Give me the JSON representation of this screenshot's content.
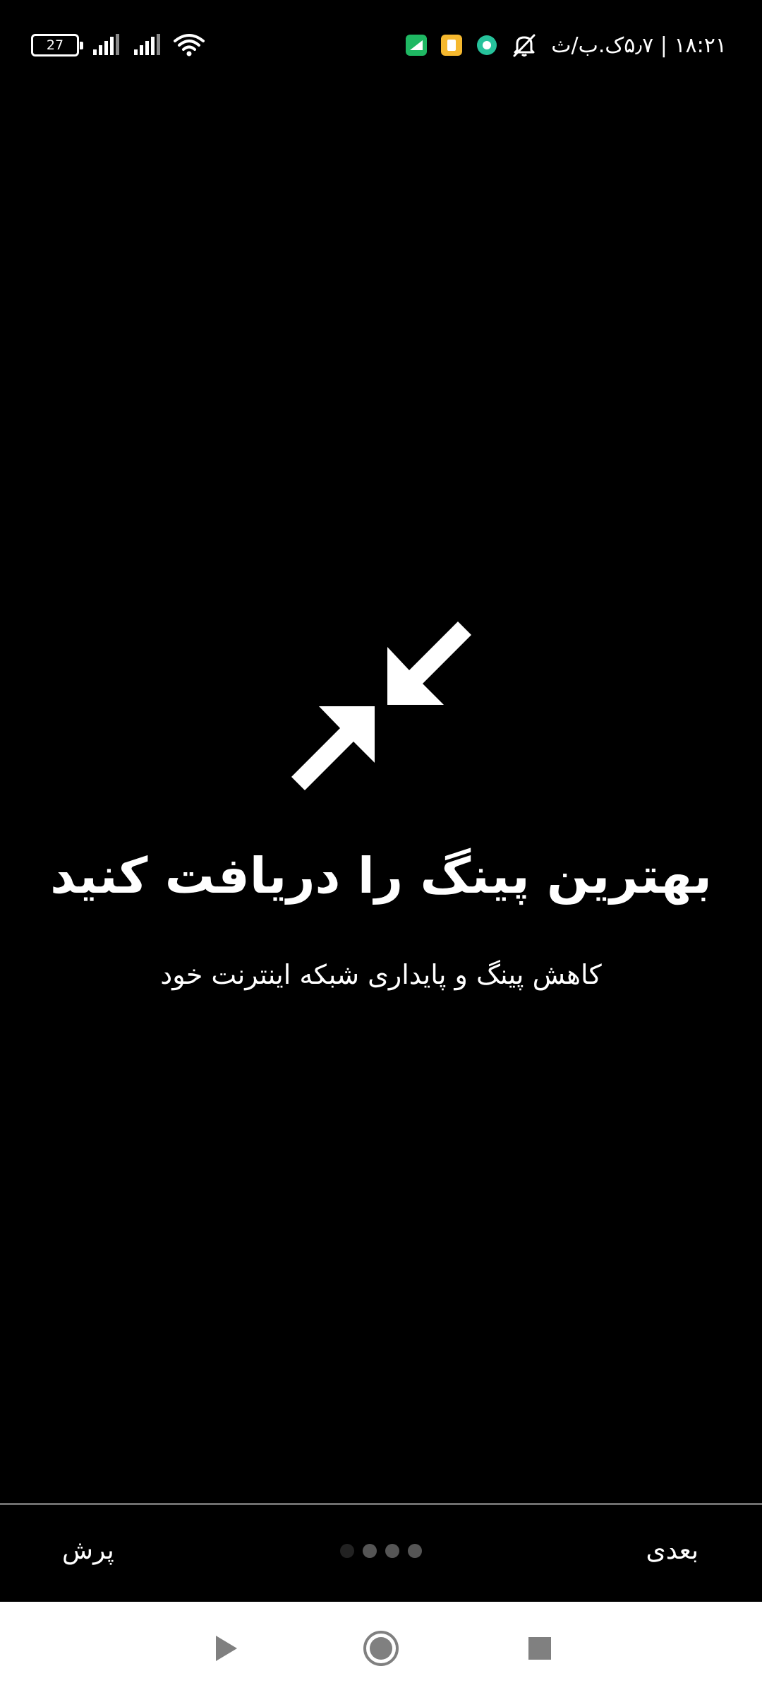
{
  "status_bar": {
    "time": "۱۸:۲۱ | ۵٫۷ک.ب/ث",
    "battery_level": "27",
    "icons": [
      "battery-icon",
      "signal-icon",
      "signal-icon",
      "wifi-icon",
      "mute-icon",
      "app-notification-icon"
    ],
    "app_icon_colors": [
      "#1fb863",
      "#f5b82e",
      "#26c29b"
    ]
  },
  "hero": {
    "icon": "compress-arrows-icon",
    "title": "بهترین پینگ را دریافت کنید",
    "subtitle": "کاهش پینگ و پایداری شبکه اینترنت خود"
  },
  "bottom_bar": {
    "skip_label": "پرش",
    "next_label": "بعدی",
    "page_count": 4,
    "current_page": 2
  },
  "system_nav": {
    "buttons": [
      "back-icon",
      "home-icon",
      "recents-icon"
    ]
  }
}
